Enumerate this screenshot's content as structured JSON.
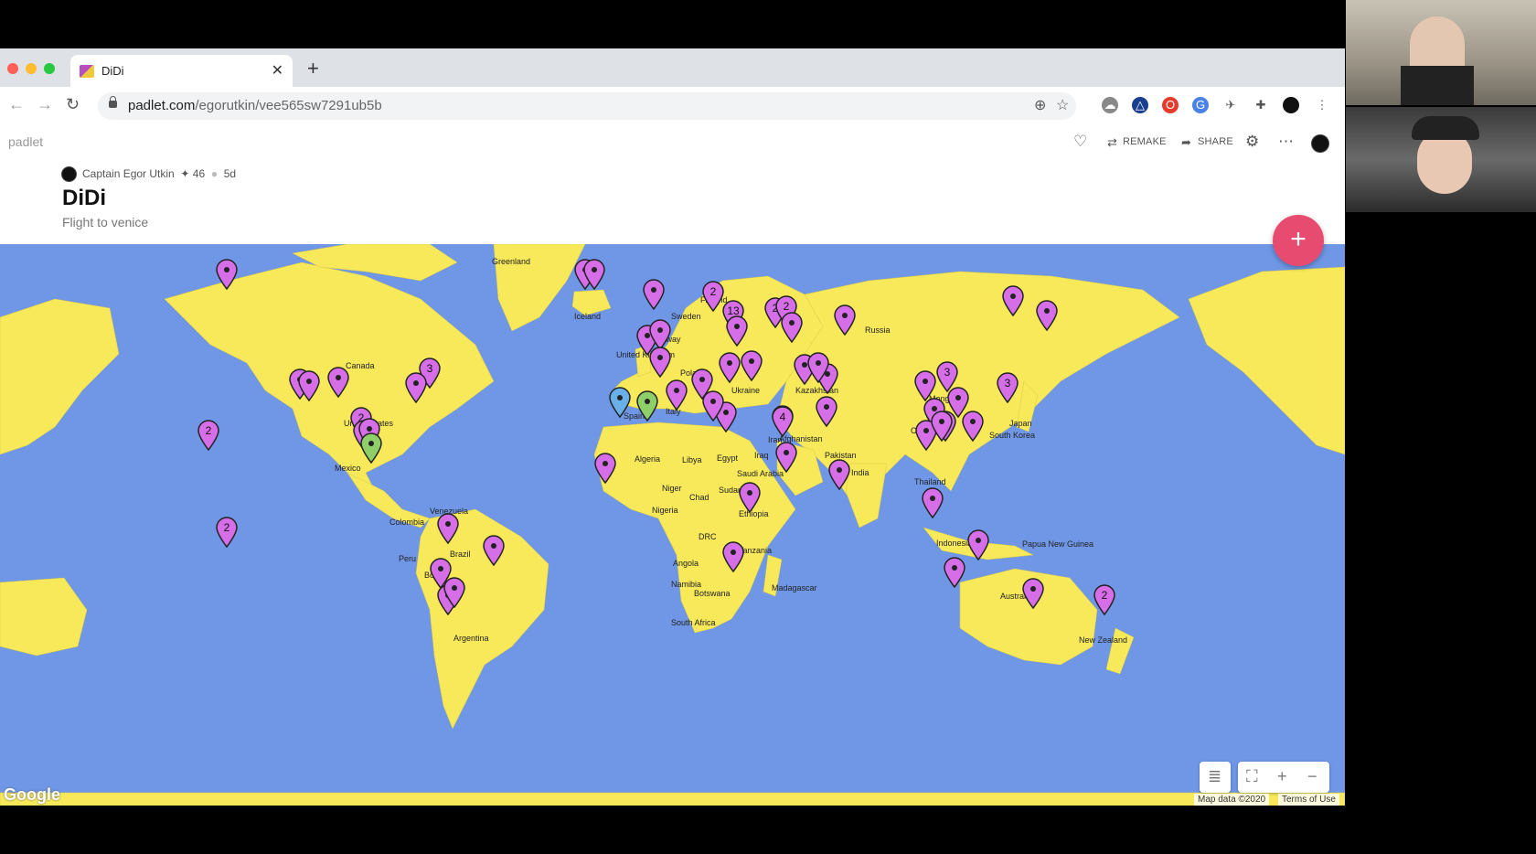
{
  "browser": {
    "tab_title": "DiDi",
    "url_domain": "padlet.com",
    "url_path": "/egorutkin/vee565sw7291ub5b"
  },
  "padlet": {
    "brand": "padlet",
    "remake_label": "REMAKE",
    "share_label": "SHARE",
    "author": "Captain Egor Utkin",
    "karma": "✦ 46",
    "age": "5d",
    "title": "DiDi",
    "subtitle": "Flight to venice"
  },
  "map": {
    "labels": [
      "Greenland",
      "Canada",
      "United States",
      "Mexico",
      "Venezuela",
      "Colombia",
      "Peru",
      "Brazil",
      "Bolivia",
      "Argentina",
      "Iceland",
      "Finland",
      "Sweden",
      "Norway",
      "United Kingdom",
      "Poland",
      "Spain",
      "Italy",
      "Ukraine",
      "Russia",
      "Kazakhstan",
      "Mongolia",
      "China",
      "South Korea",
      "Japan",
      "Iran",
      "Iraq",
      "Afghanistan",
      "Pakistan",
      "India",
      "Thailand",
      "Algeria",
      "Libya",
      "Egypt",
      "Saudi Arabia",
      "Niger",
      "Chad",
      "Sudan",
      "Nigeria",
      "Ethiopia",
      "DRC",
      "Tanzania",
      "Angola",
      "Namibia",
      "Botswana",
      "Madagascar",
      "South Africa",
      "Indonesia",
      "Papua New Guinea",
      "Australia",
      "New Zealand"
    ],
    "pins": [
      {
        "count": ""
      },
      {
        "count": "2"
      },
      {
        "count": "2"
      },
      {
        "count": "3"
      },
      {
        "count": ""
      },
      {
        "count": "2"
      },
      {
        "count": ""
      },
      {
        "count": ""
      },
      {
        "count": ""
      },
      {
        "count": ""
      },
      {
        "count": ""
      },
      {
        "count": ""
      },
      {
        "count": ""
      },
      {
        "count": ""
      },
      {
        "count": "2"
      },
      {
        "count": "13"
      },
      {
        "count": "2"
      },
      {
        "count": "2"
      },
      {
        "count": ""
      },
      {
        "count": ""
      },
      {
        "count": ""
      },
      {
        "count": ""
      },
      {
        "count": ""
      },
      {
        "count": ""
      },
      {
        "count": ""
      },
      {
        "count": "4"
      },
      {
        "count": ""
      },
      {
        "count": ""
      },
      {
        "count": "3"
      },
      {
        "count": "2"
      },
      {
        "count": "3"
      },
      {
        "count": ""
      },
      {
        "count": ""
      },
      {
        "count": ""
      },
      {
        "count": ""
      },
      {
        "count": ""
      },
      {
        "count": "2"
      },
      {
        "count": ""
      },
      {
        "count": ""
      }
    ],
    "attribution": "Map data ©2020",
    "terms": "Terms of Use",
    "google": "Google"
  },
  "colors": {
    "ocean": "#6f97e6",
    "land": "#f7e95a",
    "pin": "#d66ee8",
    "pin_blue": "#6ab0e8",
    "pin_green": "#8fcf6a",
    "fab": "#e84b70"
  },
  "icons": {
    "heart": "heart-icon",
    "remake": "remake-icon",
    "share": "share-icon",
    "settings": "gear-icon",
    "more": "more-icon",
    "add": "plus-icon"
  }
}
